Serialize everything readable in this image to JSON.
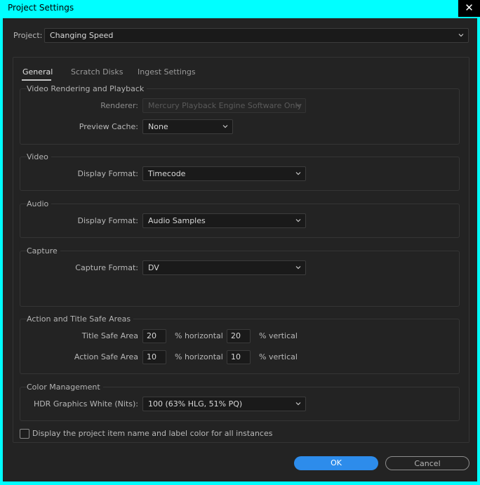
{
  "window": {
    "title": "Project Settings",
    "close_glyph": "✕"
  },
  "project": {
    "label": "Project:",
    "value": "Changing Speed"
  },
  "tabs": [
    {
      "label": "General",
      "active": true
    },
    {
      "label": "Scratch Disks",
      "active": false
    },
    {
      "label": "Ingest Settings",
      "active": false
    }
  ],
  "video_rendering": {
    "title": "Video Rendering and Playback",
    "renderer_label": "Renderer:",
    "renderer_value": "Mercury Playback Engine Software Only",
    "preview_cache_label": "Preview Cache:",
    "preview_cache_value": "None"
  },
  "video": {
    "title": "Video",
    "display_format_label": "Display Format:",
    "display_format_value": "Timecode"
  },
  "audio": {
    "title": "Audio",
    "display_format_label": "Display Format:",
    "display_format_value": "Audio Samples"
  },
  "capture": {
    "title": "Capture",
    "capture_format_label": "Capture Format:",
    "capture_format_value": "DV"
  },
  "safe_areas": {
    "title": "Action and Title Safe Areas",
    "title_safe_label": "Title Safe Area",
    "title_safe_h": "20",
    "title_safe_v": "20",
    "action_safe_label": "Action Safe Area",
    "action_safe_h": "10",
    "action_safe_v": "10",
    "horizontal_unit": "% horizontal",
    "vertical_unit": "% vertical"
  },
  "color_management": {
    "title": "Color Management",
    "hdr_label": "HDR Graphics White (Nits):",
    "hdr_value": "100 (63% HLG, 51% PQ)"
  },
  "display_label_checkbox": {
    "label": "Display the project item name and label color for all instances",
    "checked": false
  },
  "buttons": {
    "ok": "OK",
    "cancel": "Cancel"
  },
  "colors": {
    "accent": "#2d8ceb",
    "titlebar": "#00ffff",
    "panel_bg": "#232323"
  }
}
